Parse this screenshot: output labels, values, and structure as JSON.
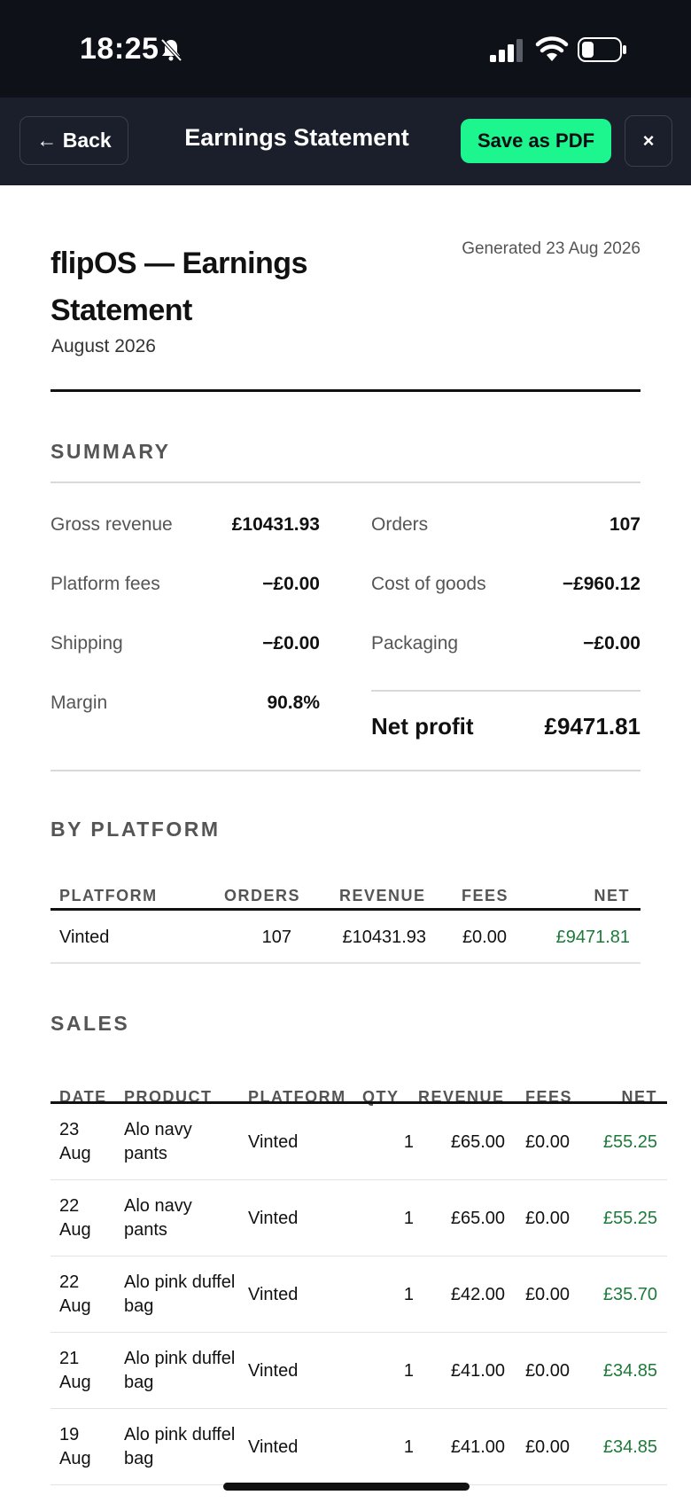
{
  "status": {
    "time": "18:25"
  },
  "nav": {
    "back_label": "← Back",
    "title": "Earnings Statement",
    "pdf_label": "Save as PDF",
    "close_label": "×"
  },
  "doc": {
    "title": "flipOS — Earnings Statement",
    "period": "August 2026",
    "generated": "Generated 23 Aug 2026"
  },
  "summary": {
    "heading": "SUMMARY",
    "left": [
      {
        "label": "Gross revenue",
        "value": "£10431.93"
      },
      {
        "label": "Platform fees",
        "value": "−£0.00"
      },
      {
        "label": "Shipping",
        "value": "−£0.00"
      },
      {
        "label": "Margin",
        "value": "90.8%"
      }
    ],
    "right": [
      {
        "label": "Orders",
        "value": "107"
      },
      {
        "label": "Cost of goods",
        "value": "−£960.12"
      },
      {
        "label": "Packaging",
        "value": "−£0.00"
      }
    ],
    "net_label": "Net profit",
    "net_value": "£9471.81"
  },
  "by_platform": {
    "heading": "BY PLATFORM",
    "columns": [
      "PLATFORM",
      "ORDERS",
      "REVENUE",
      "FEES",
      "NET"
    ],
    "rows": [
      {
        "platform": "Vinted",
        "orders": "107",
        "revenue": "£10431.93",
        "fees": "£0.00",
        "net": "£9471.81"
      }
    ]
  },
  "sales": {
    "heading": "SALES",
    "columns": [
      "DATE",
      "PRODUCT",
      "PLATFORM",
      "QTY",
      "REVENUE",
      "FEES",
      "NET"
    ],
    "rows": [
      {
        "date": "23 Aug",
        "product": "Alo navy pants",
        "platform": "Vinted",
        "qty": "1",
        "revenue": "£65.00",
        "fees": "£0.00",
        "net": "£55.25"
      },
      {
        "date": "22 Aug",
        "product": "Alo navy pants",
        "platform": "Vinted",
        "qty": "1",
        "revenue": "£65.00",
        "fees": "£0.00",
        "net": "£55.25"
      },
      {
        "date": "22 Aug",
        "product": "Alo pink duffel bag",
        "platform": "Vinted",
        "qty": "1",
        "revenue": "£42.00",
        "fees": "£0.00",
        "net": "£35.70"
      },
      {
        "date": "21 Aug",
        "product": "Alo pink duffel bag",
        "platform": "Vinted",
        "qty": "1",
        "revenue": "£41.00",
        "fees": "£0.00",
        "net": "£34.85"
      },
      {
        "date": "19 Aug",
        "product": "Alo pink duffel bag",
        "platform": "Vinted",
        "qty": "1",
        "revenue": "£41.00",
        "fees": "£0.00",
        "net": "£34.85"
      }
    ]
  },
  "colors": {
    "accent": "#1df58f",
    "navbar": "#1b1f2c",
    "statusbar": "#0f1118",
    "positive": "#1e7a3a"
  }
}
